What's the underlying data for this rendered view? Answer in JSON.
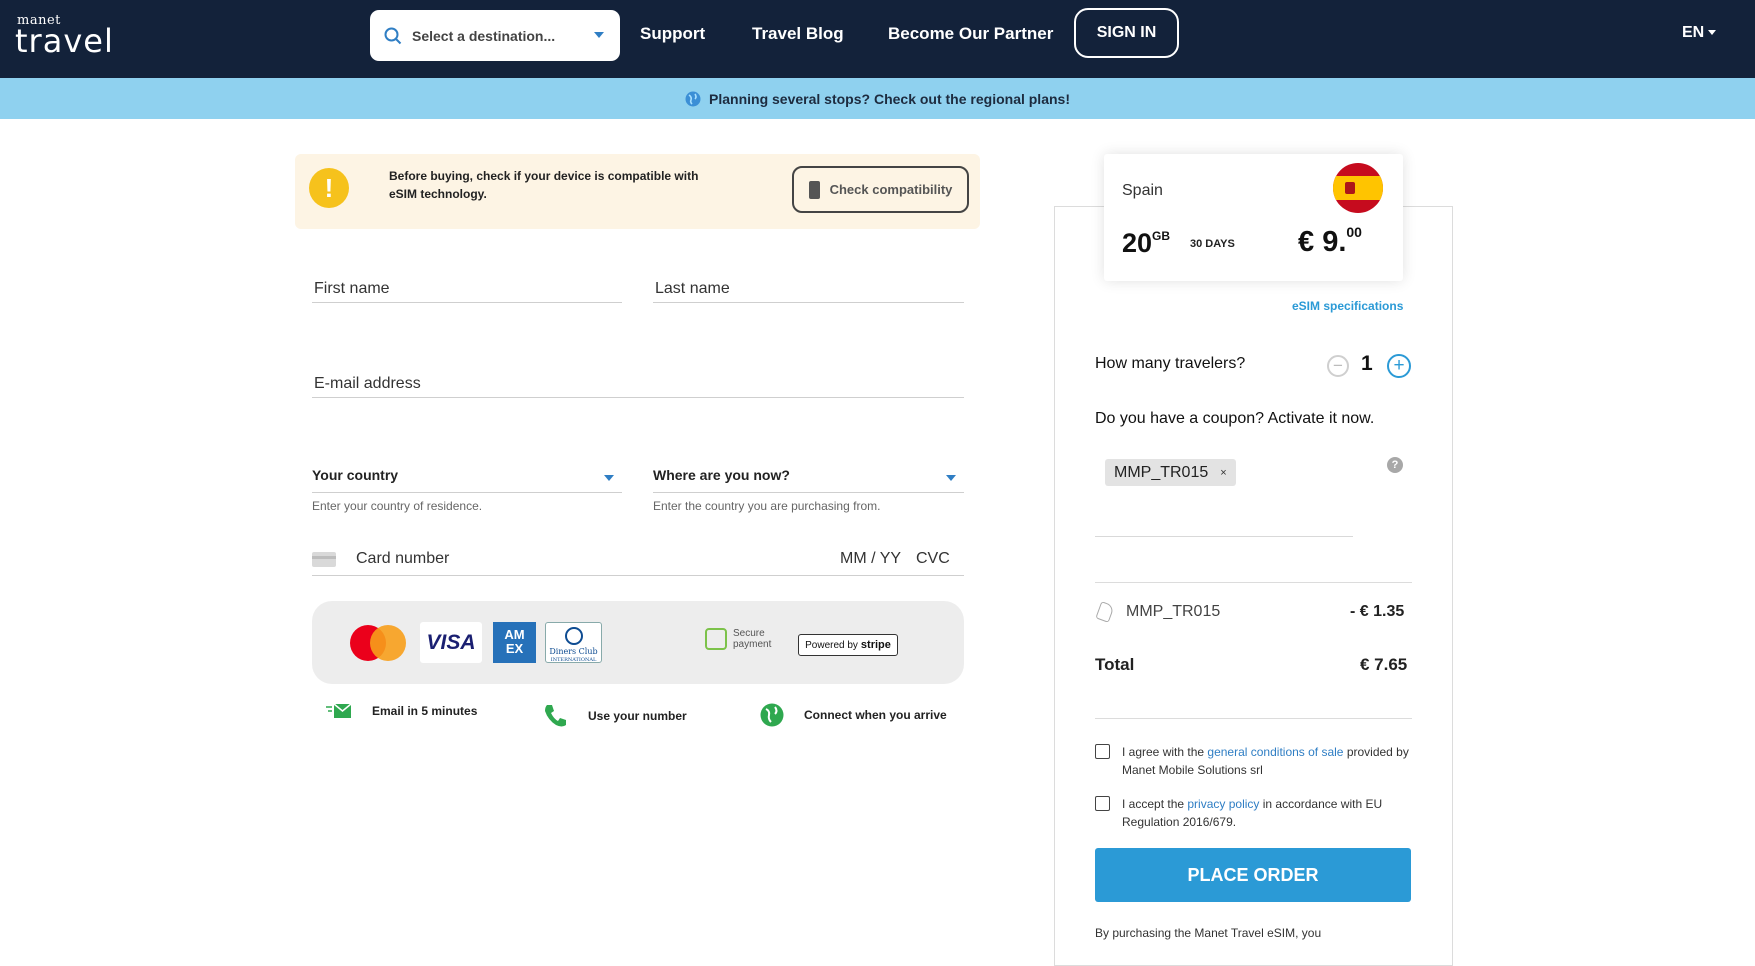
{
  "header": {
    "logo_small": "manet",
    "logo_big": "travel",
    "destination_placeholder": "Select a destination...",
    "nav": [
      "Support",
      "Travel Blog",
      "Become Our Partner"
    ],
    "sign_in": "SIGN IN",
    "language": "EN"
  },
  "banner": {
    "text": "Planning several stops? Check out the regional plans!"
  },
  "warning": {
    "text": "Before buying, check if your device is compatible with eSIM technology.",
    "button": "Check compatibility"
  },
  "form": {
    "first_name_placeholder": "First name",
    "last_name_placeholder": "Last name",
    "email_placeholder": "E-mail address",
    "country_label": "Your country",
    "country_hint": "Enter your country of residence.",
    "location_label": "Where are you now?",
    "location_hint": "Enter the country you are purchasing from.",
    "card_number": "Card number",
    "card_exp": "MM / YY",
    "card_cvc": "CVC"
  },
  "payment": {
    "visa": "VISA",
    "amex_line1": "AM",
    "amex_line2": "EX",
    "diners_line1": "Diners Club",
    "diners_line2": "INTERNATIONAL",
    "secure_line1": "Secure",
    "secure_line2": "payment",
    "stripe_prefix": "Powered by",
    "stripe_brand": "stripe"
  },
  "features": [
    {
      "icon": "email-icon",
      "label": "Email in 5 minutes"
    },
    {
      "icon": "phone-icon",
      "label": "Use your number"
    },
    {
      "icon": "globe-icon",
      "label": "Connect when you arrive"
    }
  ],
  "plan": {
    "country": "Spain",
    "data_amount": "20",
    "data_unit": "GB",
    "duration": "30 DAYS",
    "price_currency": "€",
    "price_main": "9.",
    "price_cents": "00",
    "specs_link": "eSIM specifications"
  },
  "order": {
    "travelers_label": "How many travelers?",
    "travelers_count": "1",
    "minus": "−",
    "plus": "+",
    "coupon_label": "Do you have a coupon? Activate it now.",
    "coupon_code": "MMP_TR015",
    "coupon_remove": "×",
    "help": "?",
    "discount_code": "MMP_TR015",
    "discount_amount": "- € 1.35",
    "total_label": "Total",
    "total_amount": "€ 7.65",
    "terms_pre": "I agree with the ",
    "terms_link": "general conditions of sale",
    "terms_post": " provided by Manet Mobile Solutions srl",
    "privacy_pre": "I accept the ",
    "privacy_link": "privacy policy",
    "privacy_post": " in accordance with EU Regulation 2016/679.",
    "place_order": "PLACE ORDER",
    "footer_note": "By purchasing the Manet Travel eSIM, you"
  },
  "colors": {
    "header_bg": "#13223a",
    "banner_bg": "#8fd1ef",
    "accent": "#2b9ad6",
    "warning_bg": "#fdf4e4",
    "warning_icon": "#f6c21c"
  }
}
